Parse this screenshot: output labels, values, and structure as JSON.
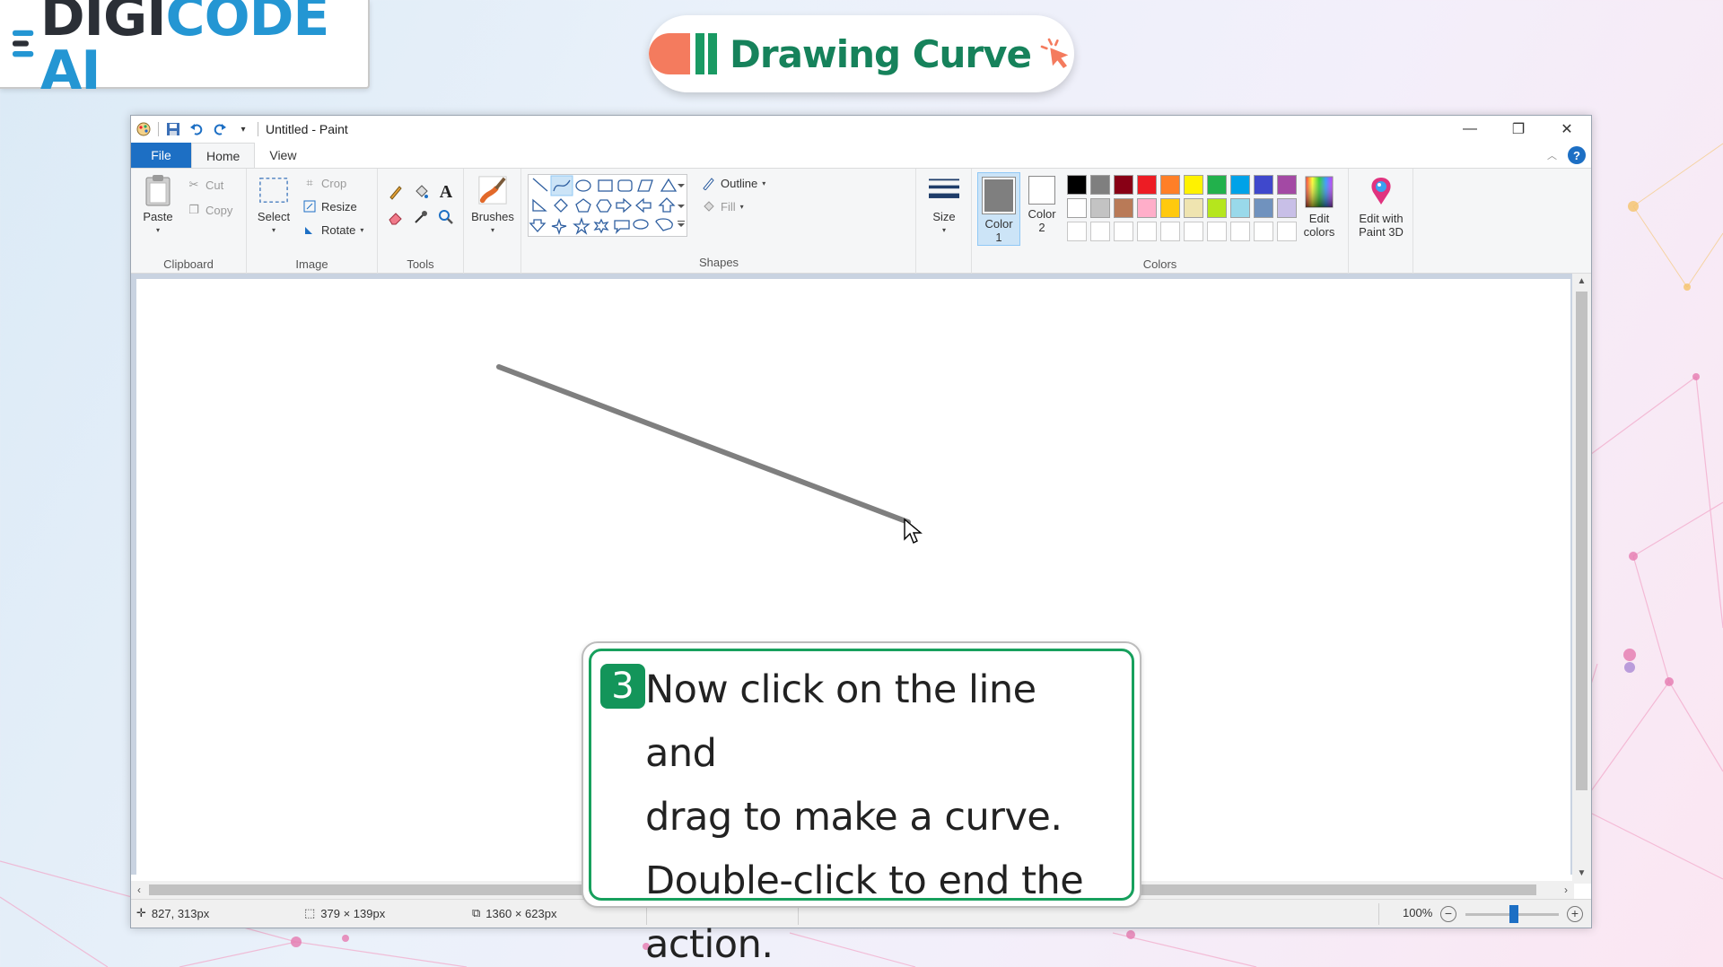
{
  "brand": {
    "logo_part1": "DIGI",
    "logo_part2": "CODE AI"
  },
  "lesson": {
    "title": "Drawing Curve"
  },
  "window": {
    "title": "Untitled - Paint",
    "controls": {
      "minimize": "—",
      "restore": "❐",
      "close": "✕"
    }
  },
  "tabs": {
    "file": "File",
    "home": "Home",
    "view": "View"
  },
  "ribbon": {
    "clipboard": {
      "label": "Clipboard",
      "paste": "Paste",
      "cut": "Cut",
      "copy": "Copy"
    },
    "image": {
      "label": "Image",
      "select": "Select",
      "crop": "Crop",
      "resize": "Resize",
      "rotate": "Rotate"
    },
    "tools": {
      "label": "Tools"
    },
    "brushes": {
      "label": "Brushes"
    },
    "shapes": {
      "label": "Shapes",
      "outline": "Outline",
      "fill": "Fill",
      "selected_shape": "curve"
    },
    "size": {
      "label": "Size"
    },
    "colors": {
      "label": "Colors",
      "color1_line1": "Color",
      "color1_line2": "1",
      "color2_line1": "Color",
      "color2_line2": "2",
      "color1_value": "#7f7f7f",
      "color2_value": "#ffffff",
      "edit_colors_line1": "Edit",
      "edit_colors_line2": "colors",
      "palette": [
        "#000000",
        "#7f7f7f",
        "#880015",
        "#ed1c24",
        "#ff7f27",
        "#fff200",
        "#22b14c",
        "#00a2e8",
        "#3f48cc",
        "#a349a4",
        "#ffffff",
        "#c3c3c3",
        "#b97a57",
        "#ffaec9",
        "#ffc90e",
        "#efe4b0",
        "#b5e61d",
        "#99d9ea",
        "#7092be",
        "#c8bfe7",
        "#ffffff",
        "#ffffff",
        "#ffffff",
        "#ffffff",
        "#ffffff",
        "#ffffff",
        "#ffffff",
        "#ffffff",
        "#ffffff",
        "#ffffff"
      ]
    },
    "paint3d": {
      "line1": "Edit with",
      "line2": "Paint 3D"
    }
  },
  "status": {
    "cursor_pos": "827, 313px",
    "selection_size": "379 × 139px",
    "canvas_size": "1360 × 623px",
    "zoom": "100%",
    "zoom_level": 1.0
  },
  "instruction": {
    "step": "3",
    "line1": "Now click on the line and",
    "line2": "drag to make a curve.",
    "line3": "Double-click to end the",
    "line4": "action."
  },
  "colors": {
    "accent_blue": "#1d6fc4",
    "brand_green": "#16825b",
    "line_color": "#7f7f7f"
  }
}
